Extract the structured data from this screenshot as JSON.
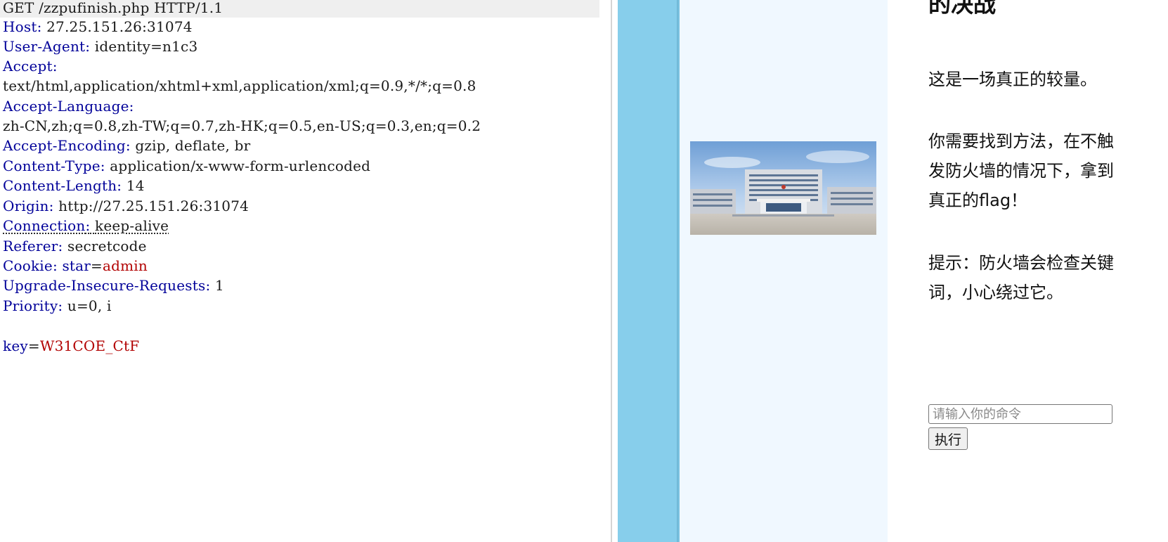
{
  "request": {
    "request_line": "GET /zzpufinish.php HTTP/1.1",
    "headers": [
      {
        "name": "Host",
        "value": "27.25.151.26:31074"
      },
      {
        "name": "User-Agent",
        "value": "identity=n1c3"
      },
      {
        "name": "Accept",
        "value": ""
      },
      {
        "name": "",
        "value": "text/html,application/xhtml+xml,application/xml;q=0.9,*/*;q=0.8"
      },
      {
        "name": "Accept-Language",
        "value": ""
      },
      {
        "name": "",
        "value": "zh-CN,zh;q=0.8,zh-TW;q=0.7,zh-HK;q=0.5,en-US;q=0.3,en;q=0.2"
      },
      {
        "name": "Accept-Encoding",
        "value": "gzip, deflate, br"
      },
      {
        "name": "Content-Type",
        "value": "application/x-www-form-urlencoded"
      },
      {
        "name": "Content-Length",
        "value": "14"
      },
      {
        "name": "Origin",
        "value": "http://27.25.151.26:31074"
      },
      {
        "name": "Connection",
        "value": "keep-alive"
      },
      {
        "name": "Referer",
        "value": "secretcode"
      },
      {
        "name": "Cookie",
        "value": ""
      },
      {
        "name": "Upgrade-Insecure-Requests",
        "value": "1"
      },
      {
        "name": "Priority",
        "value": "u=0, i"
      }
    ],
    "cookie": {
      "key": "star",
      "value": "admin"
    },
    "body": {
      "key": "key",
      "value": "W31COE_CtF"
    }
  },
  "page": {
    "heading": "的决战",
    "paragraph_1": "这是一场真正的较量。",
    "paragraph_2": "你需要找到方法，在不触发防火墙的情况下，拿到真正的flag！",
    "paragraph_3": "提示：防火墙会检查关键词，小心绕过它。",
    "command_placeholder": "请输入你的命令",
    "execute_label": "执行",
    "colors": {
      "sidebar": "#87ceeb",
      "panel": "#f0f8ff",
      "header_name": "#000099",
      "param_value": "#b20000"
    }
  }
}
